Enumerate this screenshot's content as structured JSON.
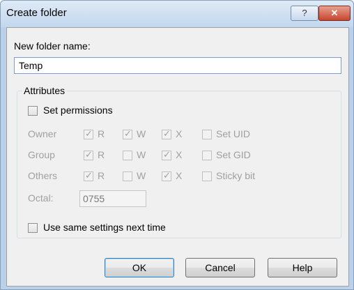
{
  "window": {
    "title": "Create folder",
    "help_glyph": "?",
    "close_glyph": "✕"
  },
  "form": {
    "name_label": "New folder name:",
    "name_value": "Temp",
    "attributes_label": "Attributes",
    "set_permissions_label": "Set permissions",
    "set_permissions_checked": false,
    "rows": [
      {
        "label": "Owner",
        "r": true,
        "w": true,
        "x": true,
        "extra_label": "Set UID",
        "extra_checked": false
      },
      {
        "label": "Group",
        "r": true,
        "w": false,
        "x": true,
        "extra_label": "Set GID",
        "extra_checked": false
      },
      {
        "label": "Others",
        "r": true,
        "w": false,
        "x": true,
        "extra_label": "Sticky bit",
        "extra_checked": false
      }
    ],
    "perm_letters": {
      "r": "R",
      "w": "W",
      "x": "X"
    },
    "octal_label": "Octal:",
    "octal_value": "0755",
    "same_settings_label": "Use same settings next time",
    "same_settings_checked": false
  },
  "buttons": {
    "ok": "OK",
    "cancel": "Cancel",
    "help": "Help"
  }
}
